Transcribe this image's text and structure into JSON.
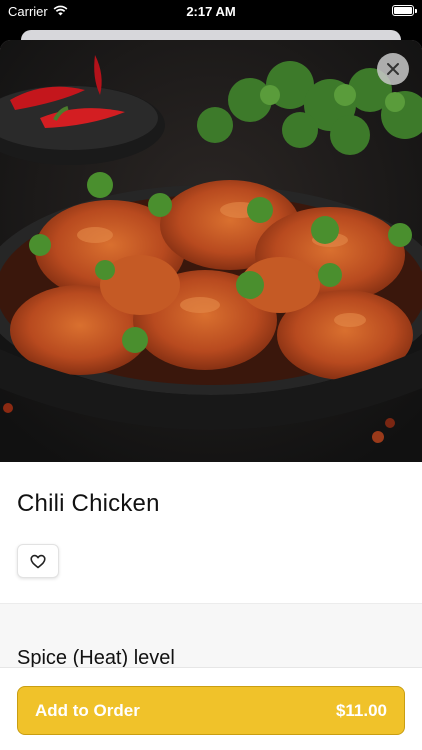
{
  "status_bar": {
    "carrier": "Carrier",
    "time": "2:17 AM"
  },
  "item": {
    "name": "Chili Chicken",
    "image_description": "Chili chicken dish with cilantro"
  },
  "sections": {
    "spice_title": "Spice (Heat) level"
  },
  "order": {
    "label": "Add to Order",
    "price": "$11.00"
  },
  "colors": {
    "accent": "#f0c22a",
    "accent_border": "#c99e12"
  },
  "icons": {
    "close": "close-icon",
    "favorite": "heart-icon",
    "wifi": "wifi-icon",
    "battery": "battery-icon"
  }
}
